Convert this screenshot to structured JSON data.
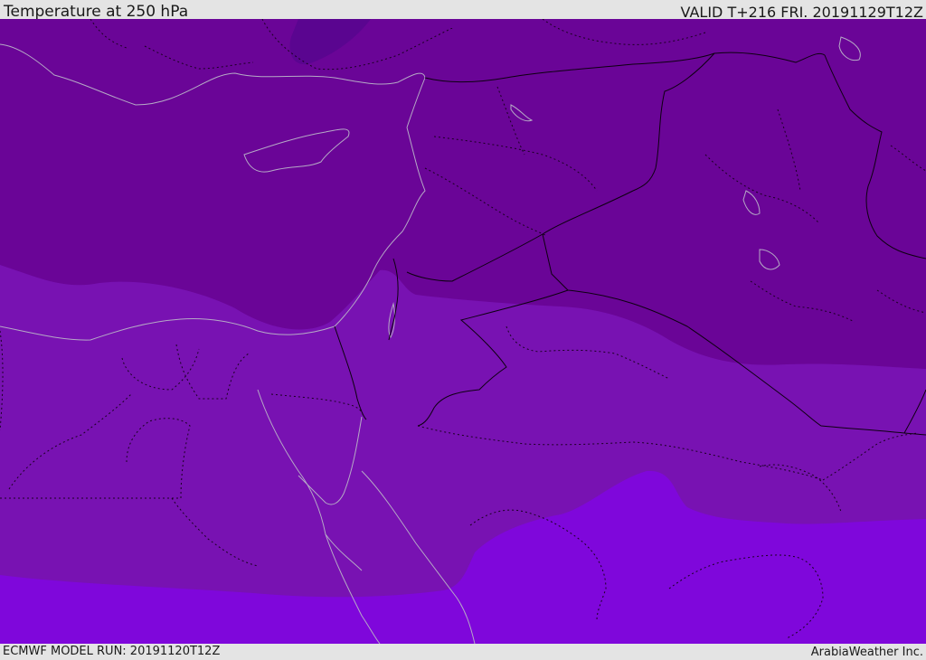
{
  "header": {
    "title": "Temperature at 250 hPa",
    "valid_time": "VALID T+216 FRI. 20191129T12Z"
  },
  "footer": {
    "model_run": "ECMWF MODEL RUN: 20191120T12Z",
    "credit": "ArabiaWeather Inc."
  },
  "colors": {
    "band_coldest": "#5a0590",
    "band_cold": "#6a0597",
    "band_mid": "#7812b2",
    "band_warm": "#7f07db",
    "coastline": "#b5a9c6",
    "border": "#0d0010",
    "province": "#1a0020"
  }
}
